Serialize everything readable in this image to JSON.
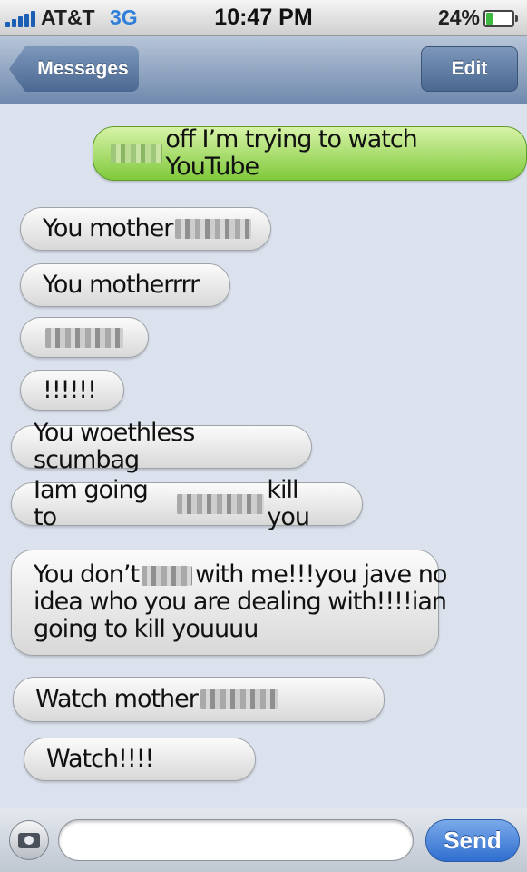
{
  "status_bar": {
    "carrier": "AT&T",
    "network": "3G",
    "time": "10:47 PM",
    "battery_percent": "24%",
    "battery_level": 0.24,
    "signal_bars": 5
  },
  "nav": {
    "back_label": "Messages",
    "edit_label": "Edit"
  },
  "messages": [
    {
      "direction": "outgoing",
      "before": "",
      "after": "off I’m trying to watch YouTube",
      "redacted": true
    },
    {
      "direction": "incoming",
      "before": "You mother",
      "after": "",
      "redacted": true
    },
    {
      "direction": "incoming",
      "before": "You motherrrr",
      "after": "",
      "redacted": false
    },
    {
      "direction": "incoming",
      "before": "",
      "after": "",
      "redacted": true
    },
    {
      "direction": "incoming",
      "before": "!!!!!!",
      "after": "",
      "redacted": false
    },
    {
      "direction": "incoming",
      "before": "You woethless scumbag",
      "after": "",
      "redacted": false
    },
    {
      "direction": "incoming",
      "before": "Iam going to",
      "after": "kill you",
      "redacted": true
    },
    {
      "direction": "incoming",
      "before": "You don’t",
      "after": "with me!!!you jave no",
      "line2": "idea who you are dealing with!!!!ian",
      "line3": "going to kill youuuu",
      "redacted": true
    },
    {
      "direction": "incoming",
      "before": "Watch mother",
      "after": "",
      "redacted": true
    },
    {
      "direction": "incoming",
      "before": "Watch!!!!",
      "after": "",
      "redacted": false
    }
  ],
  "compose": {
    "camera_icon": "camera-icon",
    "input_value": "",
    "send_label": "Send"
  },
  "colors": {
    "outgoing_bubble": "#8fd14f",
    "incoming_bubble": "#eeeeee",
    "nav_bar": "#6f89ad",
    "send_button": "#2f6fcf",
    "background": "#dbe2ed"
  }
}
